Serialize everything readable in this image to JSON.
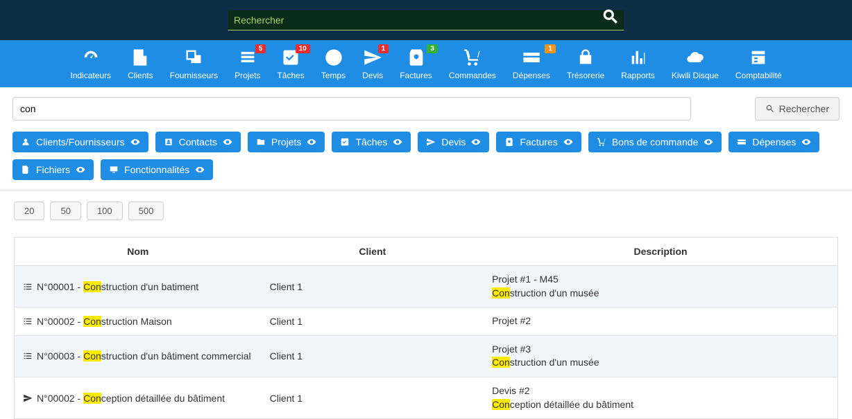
{
  "top_search": {
    "placeholder": "Rechercher"
  },
  "nav": {
    "items": [
      {
        "label": "Indicateurs",
        "badge": null,
        "badge_color": null
      },
      {
        "label": "Clients",
        "badge": null,
        "badge_color": null
      },
      {
        "label": "Fournisseurs",
        "badge": null,
        "badge_color": null
      },
      {
        "label": "Projets",
        "badge": "5",
        "badge_color": ""
      },
      {
        "label": "Tâches",
        "badge": "10",
        "badge_color": ""
      },
      {
        "label": "Temps",
        "badge": null,
        "badge_color": null
      },
      {
        "label": "Devis",
        "badge": "1",
        "badge_color": ""
      },
      {
        "label": "Factures",
        "badge": "3",
        "badge_color": "green"
      },
      {
        "label": "Commandes",
        "badge": null,
        "badge_color": null
      },
      {
        "label": "Dépenses",
        "badge": "1",
        "badge_color": "orange"
      },
      {
        "label": "Trésorerie",
        "badge": null,
        "badge_color": null
      },
      {
        "label": "Rapports",
        "badge": null,
        "badge_color": null
      },
      {
        "label": "Kiwili Disque",
        "badge": null,
        "badge_color": null
      },
      {
        "label": "Comptabilité",
        "badge": null,
        "badge_color": null
      }
    ]
  },
  "search": {
    "value": "con",
    "button": "Rechercher"
  },
  "filters": [
    "Clients/Fournisseurs",
    "Contacts",
    "Projets",
    "Tâches",
    "Devis",
    "Factures",
    "Bons de commande",
    "Dépenses",
    "Fichiers",
    "Fonctionnalités"
  ],
  "page_sizes": [
    "20",
    "50",
    "100",
    "500"
  ],
  "table": {
    "headers": {
      "nom": "Nom",
      "client": "Client",
      "description": "Description"
    },
    "rows": [
      {
        "type": "project",
        "nom_prefix": "N°00001 - ",
        "nom_hl": "Con",
        "nom_suffix": "struction d'un batiment",
        "client": "Client 1",
        "desc_line1": "Projet #1 - M45",
        "desc_hl": "Con",
        "desc_suffix": "struction d'un musée"
      },
      {
        "type": "project",
        "nom_prefix": "N°00002 - ",
        "nom_hl": "Con",
        "nom_suffix": "struction Maison",
        "client": "Client 1",
        "desc_line1": "Projet #2",
        "desc_hl": "",
        "desc_suffix": ""
      },
      {
        "type": "project",
        "nom_prefix": "N°00003 - ",
        "nom_hl": "Con",
        "nom_suffix": "struction d'un bâtiment commercial",
        "client": "Client 1",
        "desc_line1": "Projet #3",
        "desc_hl": "Con",
        "desc_suffix": "struction d'un musée"
      },
      {
        "type": "quote",
        "nom_prefix": "N°00002 - ",
        "nom_hl": "Con",
        "nom_suffix": "ception détaillée du bâtiment",
        "client": "Client 1",
        "desc_line1": "Devis #2",
        "desc_hl": "Con",
        "desc_suffix": "ception détaillée du bâtiment"
      }
    ]
  }
}
